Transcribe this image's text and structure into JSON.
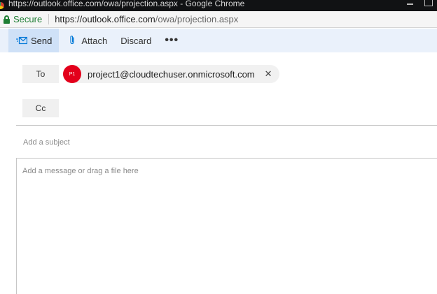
{
  "browser": {
    "window_title": "https://outlook.office.com/owa/projection.aspx - Google Chrome",
    "secure_label": "Secure",
    "url_host": "https://outlook.office.com",
    "url_path": "/owa/projection.aspx"
  },
  "toolbar": {
    "send_label": "Send",
    "attach_label": "Attach",
    "discard_label": "Discard",
    "more_label": "•••"
  },
  "recipients": {
    "to_label": "To",
    "cc_label": "Cc",
    "to_chips": [
      {
        "initials": "P1",
        "email": "project1@cloudtechuser.onmicrosoft.com",
        "remove_label": "✕"
      }
    ]
  },
  "compose": {
    "subject_placeholder": "Add a subject",
    "body_placeholder": "Add a message or drag a file here"
  },
  "colors": {
    "accent": "#0078d7",
    "avatar": "#e3001b",
    "secure": "#1e7e34"
  },
  "icons": {
    "send": "send-icon",
    "attach": "paperclip-icon",
    "lock": "lock-icon",
    "remove": "close-icon"
  }
}
